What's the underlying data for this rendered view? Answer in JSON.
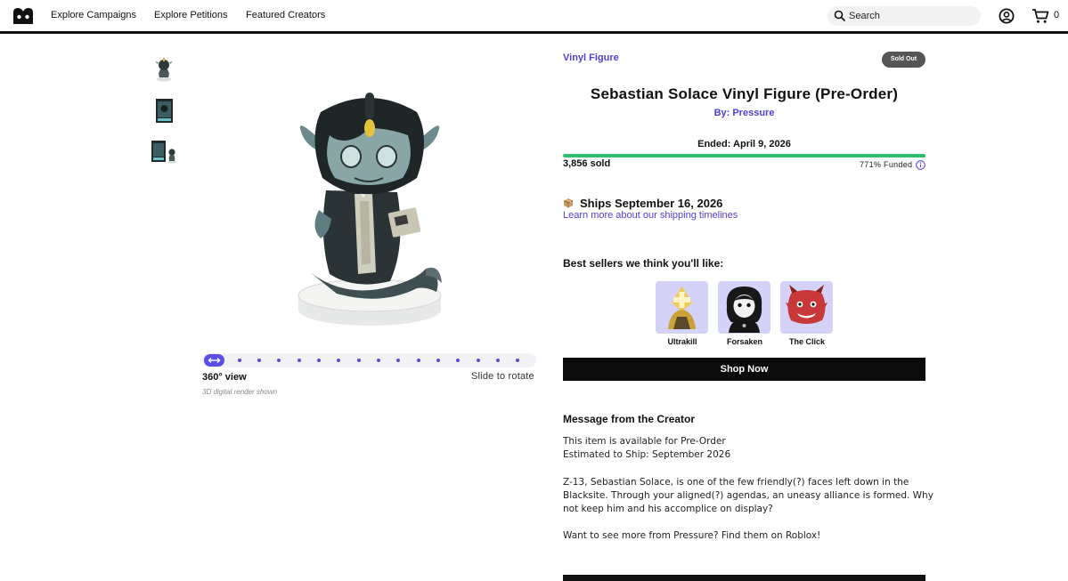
{
  "header": {
    "nav": [
      "Explore Campaigns",
      "Explore Petitions",
      "Featured Creators"
    ],
    "search_placeholder": "Search",
    "cart_count": "0"
  },
  "gallery": {
    "view_label": "360° view",
    "render_note": "3D digital render shown",
    "slide_hint": "Slide to rotate"
  },
  "product": {
    "category": "Vinyl Figure",
    "status_badge": "Sold Out",
    "title": "Sebastian Solace Vinyl Figure (Pre-Order)",
    "byline": "By: Pressure",
    "ended": "Ended: April 9, 2026",
    "sold": "3,856 sold",
    "funded_percent": 771,
    "funded_text": "771% Funded",
    "ships": "Ships September 16, 2026",
    "shipping_link": "Learn more about our shipping timelines"
  },
  "recommendations": {
    "heading": "Best sellers we think you'll like:",
    "items": [
      "Ultrakill",
      "Forsaken",
      "The Click"
    ],
    "button": "Shop Now"
  },
  "message": {
    "heading": "Message from the Creator",
    "lines": [
      "This item is available for Pre-Order",
      "Estimated to Ship: September 2026",
      "Z-13, Sebastian Solace, is one of the few friendly(?) faces left down in the",
      "Blacksite. Through your aligned(?) agendas, an uneasy alliance is formed. Why",
      "not keep him and his accomplice on display?",
      "Want to see more from Pressure? Find them on Roblox!"
    ]
  },
  "colors": {
    "accent": "#4f3fd6",
    "progress": "#2dbf6b",
    "badge": "#555555",
    "recommendation_bg": "#d4d2f7"
  }
}
